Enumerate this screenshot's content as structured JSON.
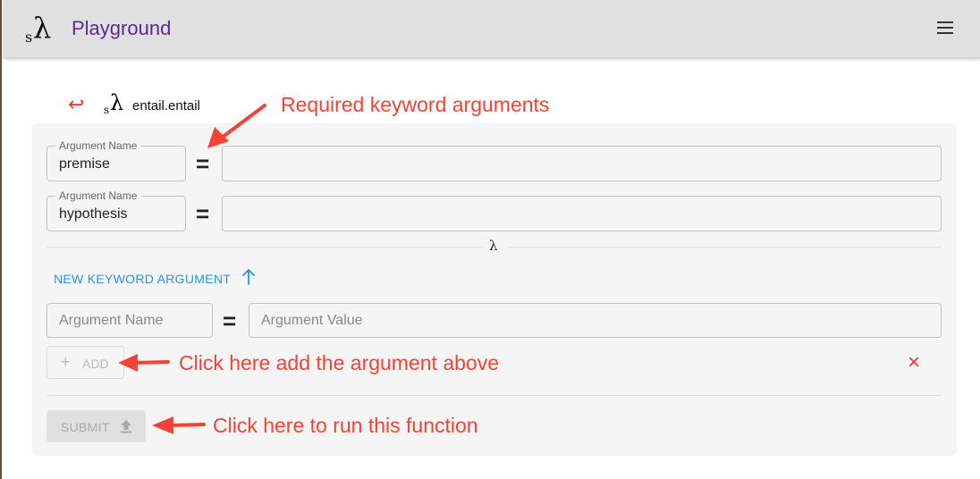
{
  "app": {
    "logo_s": "s",
    "logo_lambda": "λ",
    "title": "Playground"
  },
  "header": {
    "menu_icon": "hamburger-menu-icon"
  },
  "breadcrumb": {
    "back_icon": "↩",
    "logo_s": "s",
    "logo_lambda": "λ",
    "function_name": "entail.entail"
  },
  "arguments": [
    {
      "legend": "Argument Name",
      "name": "premise",
      "equals": "=",
      "value": ""
    },
    {
      "legend": "Argument Name",
      "name": "hypothesis",
      "equals": "=",
      "value": ""
    }
  ],
  "separator": {
    "symbol": "λ"
  },
  "new_argument": {
    "label": "NEW KEYWORD ARGUMENT",
    "name_placeholder": "Argument Name",
    "equals": "=",
    "value_placeholder": "Argument Value"
  },
  "add_button": {
    "icon": "+",
    "label": "ADD"
  },
  "clear_icon": "×",
  "submit_button": {
    "label": "SUBMIT"
  },
  "annotations": {
    "required": "Required keyword arguments",
    "add": "Click here add the argument above",
    "submit": "Click here to run this function"
  },
  "colors": {
    "brand": "#5b2a96",
    "accent": "#2196f3",
    "danger": "#e53935",
    "annotation": "#f44336"
  }
}
